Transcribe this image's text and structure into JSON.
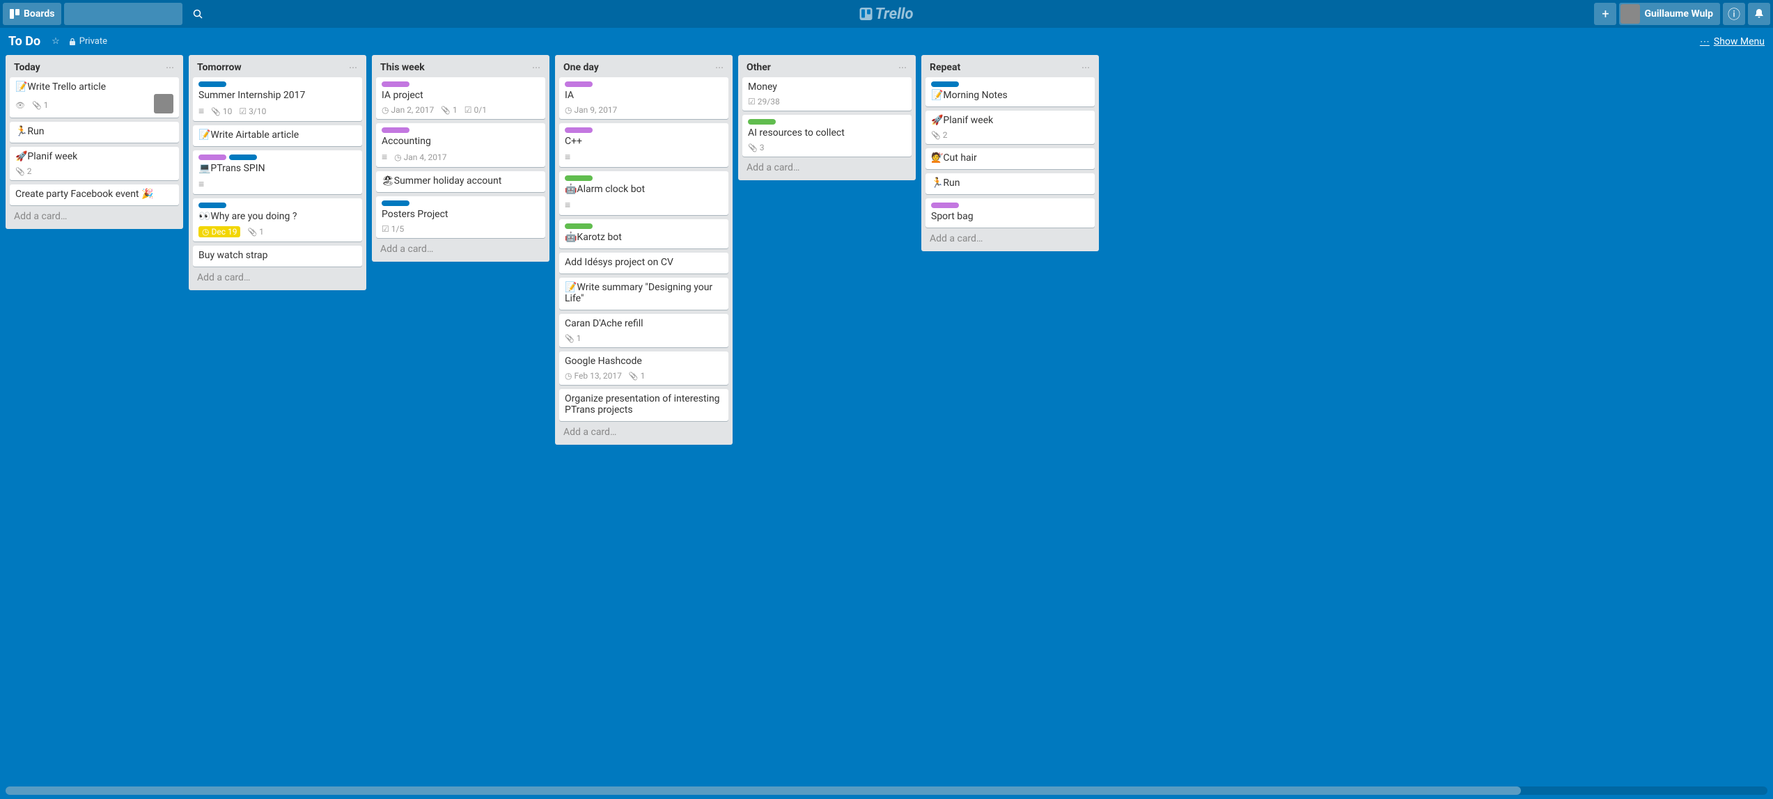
{
  "header": {
    "boards_label": "Boards",
    "logo_text": "Trello",
    "user_name": "Guillaume Wulp"
  },
  "board_bar": {
    "title": "To Do",
    "privacy": "Private",
    "show_menu": "Show Menu"
  },
  "lists": [
    {
      "title": "Today",
      "add_card": "Add a card…",
      "cards": [
        {
          "title": "📝Write Trello article",
          "badges": {
            "eye": true,
            "attach": "1"
          },
          "member": true
        },
        {
          "title": "🏃Run"
        },
        {
          "title": "🚀Planif week",
          "badges": {
            "attach": "2"
          }
        },
        {
          "title": "Create party Facebook event 🎉"
        }
      ]
    },
    {
      "title": "Tomorrow",
      "add_card": "Add a card…",
      "cards": [
        {
          "labels": [
            "blue"
          ],
          "title": "Summer Internship 2017",
          "badges": {
            "desc": true,
            "attach": "10",
            "check": "3/10"
          }
        },
        {
          "title": "📝Write Airtable article"
        },
        {
          "labels": [
            "purple",
            "blue"
          ],
          "title": "💻PTrans SPIN",
          "badges": {
            "desc": true
          }
        },
        {
          "labels": [
            "blue"
          ],
          "title": "👀Why are you doing ?",
          "date_badge": "Dec 19",
          "badges": {
            "attach": "1"
          }
        },
        {
          "title": "Buy watch strap"
        }
      ]
    },
    {
      "title": "This week",
      "add_card": "Add a card…",
      "cards": [
        {
          "labels": [
            "purple"
          ],
          "title": "IA project",
          "badges": {
            "clock": "Jan 2, 2017",
            "attach": "1",
            "check": "0/1"
          }
        },
        {
          "labels": [
            "purple"
          ],
          "title": "Accounting",
          "badges": {
            "clock": "Jan 4, 2017",
            "desc": true
          }
        },
        {
          "title": "🏖Summer holiday account"
        },
        {
          "labels": [
            "blue"
          ],
          "title": "Posters Project",
          "badges": {
            "check": "1/5"
          }
        }
      ]
    },
    {
      "title": "One day",
      "add_card": "Add a card…",
      "cards": [
        {
          "labels": [
            "purple"
          ],
          "title": "IA",
          "badges": {
            "clock": "Jan 9, 2017"
          }
        },
        {
          "labels": [
            "purple"
          ],
          "title": "C++",
          "badges": {
            "desc": true
          }
        },
        {
          "labels": [
            "green"
          ],
          "title": "🤖Alarm clock bot",
          "badges": {
            "desc": true
          }
        },
        {
          "labels": [
            "green"
          ],
          "title": "🤖Karotz bot"
        },
        {
          "title": "Add Idésys project on CV"
        },
        {
          "title": "📝Write summary \"Designing your Life\""
        },
        {
          "title": "Caran D'Ache refill",
          "badges": {
            "attach": "1"
          }
        },
        {
          "title": "Google Hashcode",
          "badges": {
            "clock": "Feb 13, 2017",
            "attach": "1"
          }
        },
        {
          "title": "Organize presentation of interesting PTrans projects"
        }
      ]
    },
    {
      "title": "Other",
      "add_card": "Add a card…",
      "cards": [
        {
          "title": "Money",
          "badges": {
            "check": "29/38"
          }
        },
        {
          "labels": [
            "green"
          ],
          "title": "AI resources to collect",
          "badges": {
            "attach": "3"
          }
        }
      ]
    },
    {
      "title": "Repeat",
      "add_card": "Add a card…",
      "cards": [
        {
          "labels": [
            "blue"
          ],
          "title": "📝Morning Notes"
        },
        {
          "title": "🚀Planif week",
          "badges": {
            "attach": "2"
          }
        },
        {
          "title": "💇Cut hair"
        },
        {
          "title": "🏃Run"
        },
        {
          "labels": [
            "purple"
          ],
          "title": "Sport bag"
        }
      ]
    }
  ]
}
